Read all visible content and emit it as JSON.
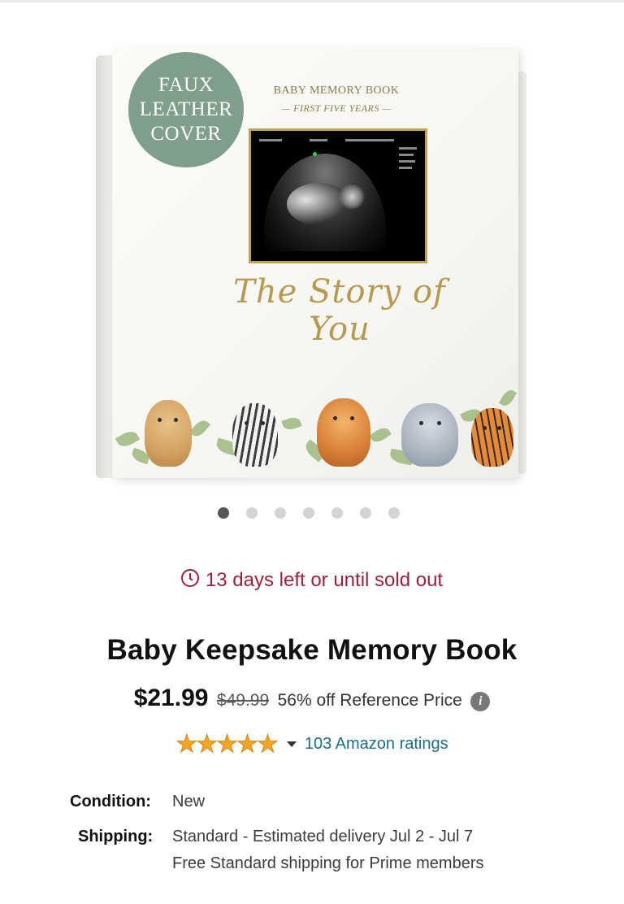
{
  "product_image": {
    "badge_lines": [
      "FAUX",
      "LEATHER",
      "COVER"
    ],
    "cover_title": "BABY MEMORY BOOK",
    "cover_subtitle": "— FIRST FIVE YEARS —",
    "cover_script": "The Story of You",
    "carousel": {
      "total": 7,
      "active_index": 0
    }
  },
  "deal": {
    "text": "13 days left or until sold out",
    "icon": "clock-icon",
    "color": "#a01f3b"
  },
  "title": "Baby Keepsake Memory Book",
  "pricing": {
    "price": "$21.99",
    "list_price": "$49.99",
    "discount_text": "56% off Reference Price",
    "info_icon": "i"
  },
  "rating": {
    "stars": 5,
    "stars_glyph": "★★★★★",
    "ratings_text": "103 Amazon ratings",
    "star_color": "#f3a624",
    "link_color": "#1a6e89"
  },
  "details": {
    "condition_label": "Condition:",
    "condition_value": "New",
    "shipping_label": "Shipping:",
    "shipping_line1": "Standard - Estimated delivery Jul 2 - Jul 7",
    "shipping_line2": "Free Standard shipping for Prime members"
  }
}
